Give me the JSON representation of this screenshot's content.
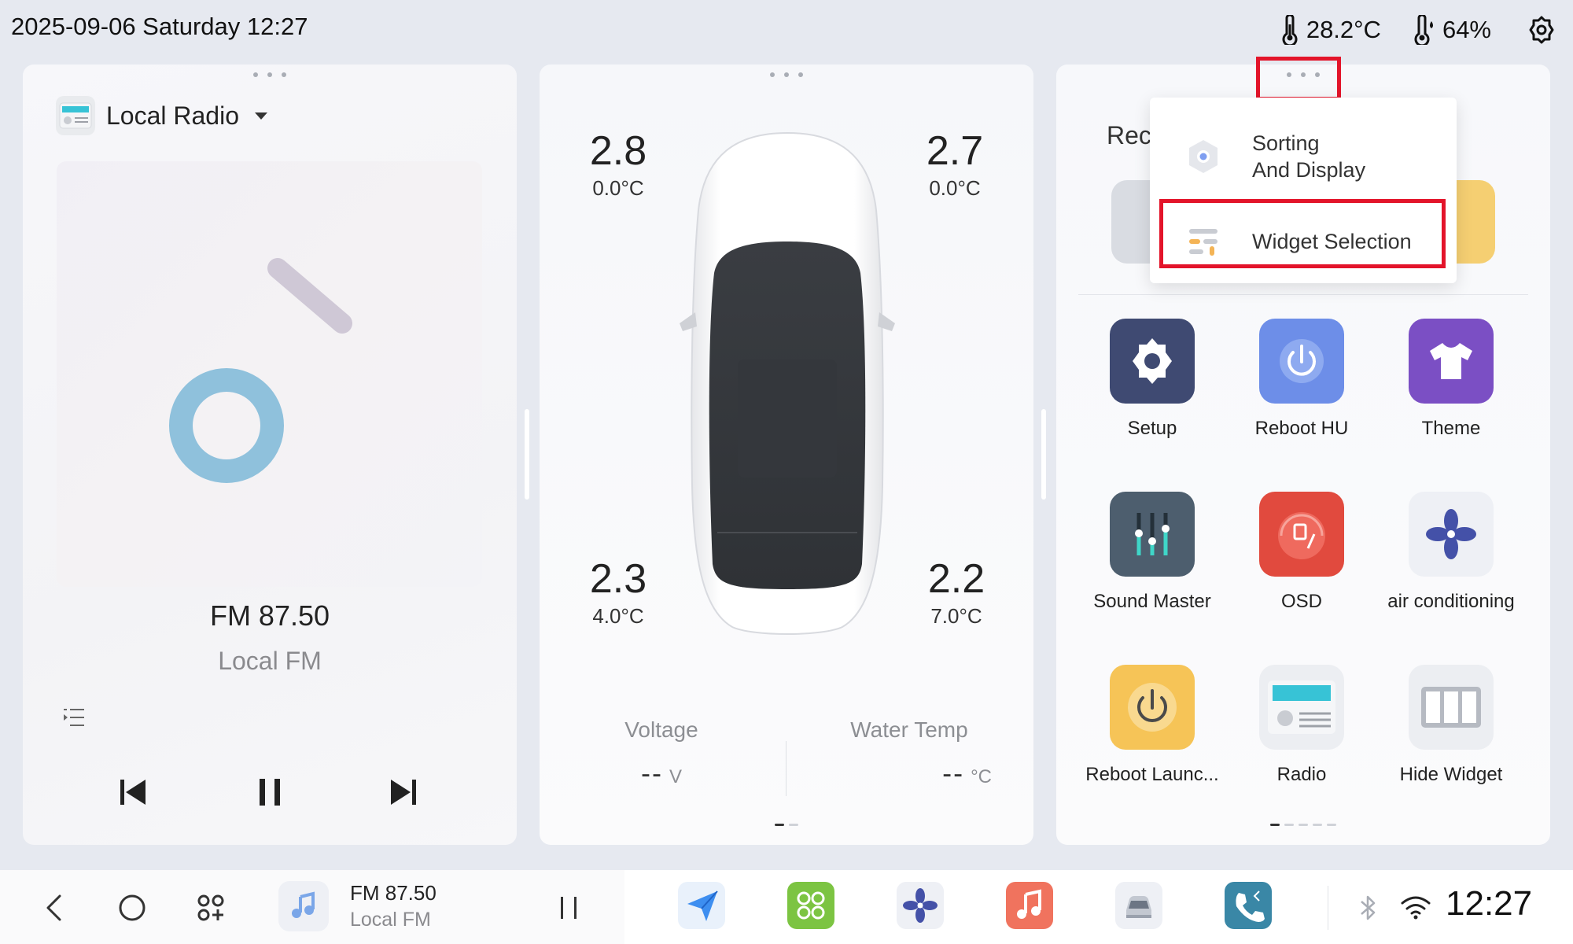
{
  "status_bar": {
    "datetime": "2025-09-06 Saturday 12:27",
    "temperature": "28.2°C",
    "humidity": "64%",
    "icons": [
      "thermometer-icon",
      "humidity-icon",
      "settings-gear-icon"
    ]
  },
  "radio": {
    "source": "Local Radio",
    "frequency": "FM 87.50",
    "station": "Local FM",
    "controls": [
      "previous-icon",
      "pause-icon",
      "next-icon"
    ]
  },
  "tires": {
    "front_left": {
      "pressure": "2.8",
      "temp": "0.0°C"
    },
    "front_right": {
      "pressure": "2.7",
      "temp": "0.0°C"
    },
    "rear_left": {
      "pressure": "2.3",
      "temp": "4.0°C"
    },
    "rear_right": {
      "pressure": "2.2",
      "temp": "7.0°C"
    }
  },
  "metrics": {
    "voltage": {
      "label": "Voltage",
      "value": "--",
      "unit": "V"
    },
    "water_temp": {
      "label": "Water Temp",
      "value": "--",
      "unit": "°C"
    }
  },
  "apps_panel": {
    "recently_label": "Rec",
    "apps": [
      {
        "label": "Setup",
        "icon": "setup-gear-icon",
        "color": "#3f4a72"
      },
      {
        "label": "Reboot HU",
        "icon": "power-icon",
        "color": "#6d8ee8"
      },
      {
        "label": "Theme",
        "icon": "tshirt-icon",
        "color": "#7b4fc4"
      },
      {
        "label": "Sound Master",
        "icon": "equalizer-icon",
        "color": "#4d5e6e"
      },
      {
        "label": "OSD",
        "icon": "fuel-gauge-icon",
        "color": "#e14a3e"
      },
      {
        "label": "air conditioning",
        "icon": "fan-icon",
        "color": "#eef0f5"
      },
      {
        "label": "Reboot Launc...",
        "icon": "power-icon",
        "color": "#f6c457"
      },
      {
        "label": "Radio",
        "icon": "radio-icon",
        "color": "#eceef2"
      },
      {
        "label": "Hide Widget",
        "icon": "columns-icon",
        "color": "#eceef2"
      }
    ]
  },
  "popup_menu": {
    "items": [
      {
        "label_line1": "Sorting",
        "label_line2": "And Display",
        "icon": "sort-display-icon"
      },
      {
        "label": "Widget Selection",
        "icon": "widget-selection-icon"
      }
    ],
    "highlight_color": "#e3142a"
  },
  "dock": {
    "now_playing": {
      "frequency": "FM 87.50",
      "station": "Local FM"
    },
    "apps": [
      "navigation-icon",
      "app-grid-icon",
      "fan-icon",
      "music-icon",
      "car-icon",
      "phone-icon"
    ],
    "clock": "12:27"
  }
}
